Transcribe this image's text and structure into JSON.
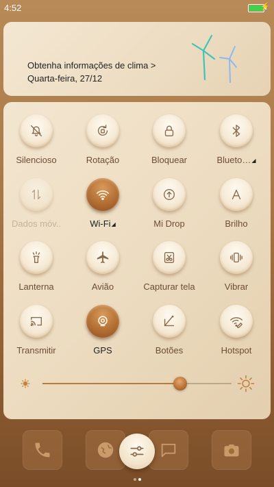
{
  "status": {
    "time": "4:52",
    "battery_color": "#3fd34a"
  },
  "weather": {
    "line1": "Obtenha informações de clima >",
    "line2": "Quarta-feira, 27/12"
  },
  "toggles": [
    {
      "label": "Silencioso",
      "icon": "bell-off-icon",
      "state": "off"
    },
    {
      "label": "Rotação",
      "icon": "rotation-lock-icon",
      "state": "off"
    },
    {
      "label": "Bloquear",
      "icon": "lock-icon",
      "state": "off"
    },
    {
      "label": "Blueto…",
      "icon": "bluetooth-icon",
      "state": "off",
      "has_menu": true
    },
    {
      "label": "Dados móv..",
      "icon": "mobile-data-icon",
      "state": "disabled"
    },
    {
      "label": "Wi-Fi",
      "icon": "wifi-icon",
      "state": "on",
      "has_menu": true
    },
    {
      "label": "Mi Drop",
      "icon": "mi-drop-icon",
      "state": "off"
    },
    {
      "label": "Brilho",
      "icon": "auto-brightness-icon",
      "state": "off"
    },
    {
      "label": "Lanterna",
      "icon": "flashlight-icon",
      "state": "off"
    },
    {
      "label": "Avião",
      "icon": "airplane-icon",
      "state": "off"
    },
    {
      "label": "Capturar tela",
      "icon": "screenshot-icon",
      "state": "off"
    },
    {
      "label": "Vibrar",
      "icon": "vibrate-icon",
      "state": "off"
    },
    {
      "label": "Transmitir",
      "icon": "cast-icon",
      "state": "off"
    },
    {
      "label": "GPS",
      "icon": "gps-icon",
      "state": "on"
    },
    {
      "label": "Botões",
      "icon": "buttons-off-icon",
      "state": "off"
    },
    {
      "label": "Hotspot",
      "icon": "hotspot-icon",
      "state": "off"
    }
  ],
  "brightness": {
    "level": 0.73
  },
  "dock": [
    "phone-icon",
    "browser-icon",
    "settings-toggle-icon",
    "messages-icon",
    "camera-icon"
  ],
  "pager": {
    "pages": 2,
    "current": 2
  },
  "colors": {
    "accent": "#b36f34",
    "panel": "#f0e2ca"
  }
}
